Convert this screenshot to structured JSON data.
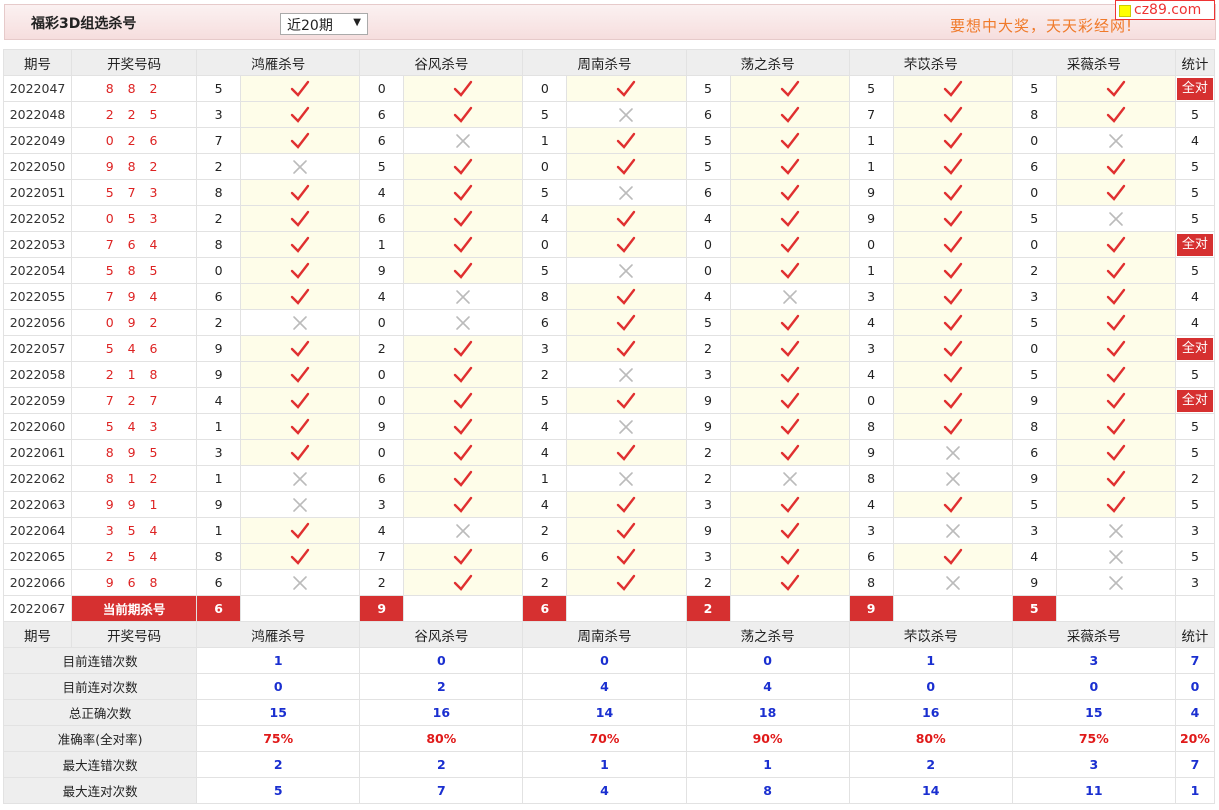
{
  "header": {
    "title": "福彩3D组选杀号",
    "select_value": "近20期",
    "slogan": "要想中大奖，天天彩经网!",
    "logo": "cz89.com"
  },
  "columns": {
    "period": "期号",
    "draw": "开奖号码",
    "experts": [
      "鸿雁杀号",
      "谷风杀号",
      "周南杀号",
      "荡之杀号",
      "芣苡杀号",
      "采薇杀号"
    ],
    "total": "统计"
  },
  "all_correct_label": "全对",
  "rows": [
    {
      "period": "2022047",
      "draw": "8 8 2",
      "kills": [
        "5",
        "0",
        "0",
        "5",
        "5",
        "5"
      ],
      "hit": [
        1,
        1,
        1,
        1,
        1,
        1
      ],
      "count": "全对"
    },
    {
      "period": "2022048",
      "draw": "2 2 5",
      "kills": [
        "3",
        "6",
        "5",
        "6",
        "7",
        "8"
      ],
      "hit": [
        1,
        1,
        0,
        1,
        1,
        1
      ],
      "count": "5"
    },
    {
      "period": "2022049",
      "draw": "0 2 6",
      "kills": [
        "7",
        "6",
        "1",
        "5",
        "1",
        "0"
      ],
      "hit": [
        1,
        0,
        1,
        1,
        1,
        0
      ],
      "count": "4"
    },
    {
      "period": "2022050",
      "draw": "9 8 2",
      "kills": [
        "2",
        "5",
        "0",
        "5",
        "1",
        "6"
      ],
      "hit": [
        0,
        1,
        1,
        1,
        1,
        1
      ],
      "count": "5"
    },
    {
      "period": "2022051",
      "draw": "5 7 3",
      "kills": [
        "8",
        "4",
        "5",
        "6",
        "9",
        "0"
      ],
      "hit": [
        1,
        1,
        0,
        1,
        1,
        1
      ],
      "count": "5"
    },
    {
      "period": "2022052",
      "draw": "0 5 3",
      "kills": [
        "2",
        "6",
        "4",
        "4",
        "9",
        "5"
      ],
      "hit": [
        1,
        1,
        1,
        1,
        1,
        0
      ],
      "count": "5"
    },
    {
      "period": "2022053",
      "draw": "7 6 4",
      "kills": [
        "8",
        "1",
        "0",
        "0",
        "0",
        "0"
      ],
      "hit": [
        1,
        1,
        1,
        1,
        1,
        1
      ],
      "count": "全对"
    },
    {
      "period": "2022054",
      "draw": "5 8 5",
      "kills": [
        "0",
        "9",
        "5",
        "0",
        "1",
        "2"
      ],
      "hit": [
        1,
        1,
        0,
        1,
        1,
        1
      ],
      "count": "5"
    },
    {
      "period": "2022055",
      "draw": "7 9 4",
      "kills": [
        "6",
        "4",
        "8",
        "4",
        "3",
        "3"
      ],
      "hit": [
        1,
        0,
        1,
        0,
        1,
        1
      ],
      "count": "4"
    },
    {
      "period": "2022056",
      "draw": "0 9 2",
      "kills": [
        "2",
        "0",
        "6",
        "5",
        "4",
        "5"
      ],
      "hit": [
        0,
        0,
        1,
        1,
        1,
        1
      ],
      "count": "4"
    },
    {
      "period": "2022057",
      "draw": "5 4 6",
      "kills": [
        "9",
        "2",
        "3",
        "2",
        "3",
        "0"
      ],
      "hit": [
        1,
        1,
        1,
        1,
        1,
        1
      ],
      "count": "全对"
    },
    {
      "period": "2022058",
      "draw": "2 1 8",
      "kills": [
        "9",
        "0",
        "2",
        "3",
        "4",
        "5"
      ],
      "hit": [
        1,
        1,
        0,
        1,
        1,
        1
      ],
      "count": "5"
    },
    {
      "period": "2022059",
      "draw": "7 2 7",
      "kills": [
        "4",
        "0",
        "5",
        "9",
        "0",
        "9"
      ],
      "hit": [
        1,
        1,
        1,
        1,
        1,
        1
      ],
      "count": "全对"
    },
    {
      "period": "2022060",
      "draw": "5 4 3",
      "kills": [
        "1",
        "9",
        "4",
        "9",
        "8",
        "8"
      ],
      "hit": [
        1,
        1,
        0,
        1,
        1,
        1
      ],
      "count": "5"
    },
    {
      "period": "2022061",
      "draw": "8 9 5",
      "kills": [
        "3",
        "0",
        "4",
        "2",
        "9",
        "6"
      ],
      "hit": [
        1,
        1,
        1,
        1,
        0,
        1
      ],
      "count": "5"
    },
    {
      "period": "2022062",
      "draw": "8 1 2",
      "kills": [
        "1",
        "6",
        "1",
        "2",
        "8",
        "9"
      ],
      "hit": [
        0,
        1,
        0,
        0,
        0,
        1
      ],
      "count": "2"
    },
    {
      "period": "2022063",
      "draw": "9 9 1",
      "kills": [
        "9",
        "3",
        "4",
        "3",
        "4",
        "5"
      ],
      "hit": [
        0,
        1,
        1,
        1,
        1,
        1
      ],
      "count": "5"
    },
    {
      "period": "2022064",
      "draw": "3 5 4",
      "kills": [
        "1",
        "4",
        "2",
        "9",
        "3",
        "3"
      ],
      "hit": [
        1,
        0,
        1,
        1,
        0,
        0
      ],
      "count": "3"
    },
    {
      "period": "2022065",
      "draw": "2 5 4",
      "kills": [
        "8",
        "7",
        "6",
        "3",
        "6",
        "4"
      ],
      "hit": [
        1,
        1,
        1,
        1,
        1,
        0
      ],
      "count": "5"
    },
    {
      "period": "2022066",
      "draw": "9 6 8",
      "kills": [
        "6",
        "2",
        "2",
        "2",
        "8",
        "9"
      ],
      "hit": [
        0,
        1,
        1,
        1,
        0,
        0
      ],
      "count": "3"
    }
  ],
  "current": {
    "period": "2022067",
    "label": "当前期杀号",
    "kills": [
      "6",
      "9",
      "6",
      "2",
      "9",
      "5"
    ]
  },
  "stats": [
    {
      "label": "目前连错次数",
      "values": [
        "1",
        "0",
        "0",
        "0",
        "1",
        "3"
      ],
      "total": "7"
    },
    {
      "label": "目前连对次数",
      "values": [
        "0",
        "2",
        "4",
        "4",
        "0",
        "0"
      ],
      "total": "0"
    },
    {
      "label": "总正确次数",
      "values": [
        "15",
        "16",
        "14",
        "18",
        "16",
        "15"
      ],
      "total": "4"
    },
    {
      "label": "准确率(全对率)",
      "values": [
        "75%",
        "80%",
        "70%",
        "90%",
        "80%",
        "75%"
      ],
      "total": "20%",
      "is_rate": true
    },
    {
      "label": "最大连错次数",
      "values": [
        "2",
        "2",
        "1",
        "1",
        "2",
        "3"
      ],
      "total": "7"
    },
    {
      "label": "最大连对次数",
      "values": [
        "5",
        "7",
        "4",
        "8",
        "14",
        "11"
      ],
      "total": "1"
    }
  ],
  "colors": {
    "accent_red": "#d63030",
    "check_red": "#e03030",
    "cross_gray": "#bbbbbb",
    "stat_blue": "#1a2fd0",
    "highlight": "#fefde9"
  },
  "icons": {
    "hit": "check-icon",
    "miss": "cross-icon"
  }
}
